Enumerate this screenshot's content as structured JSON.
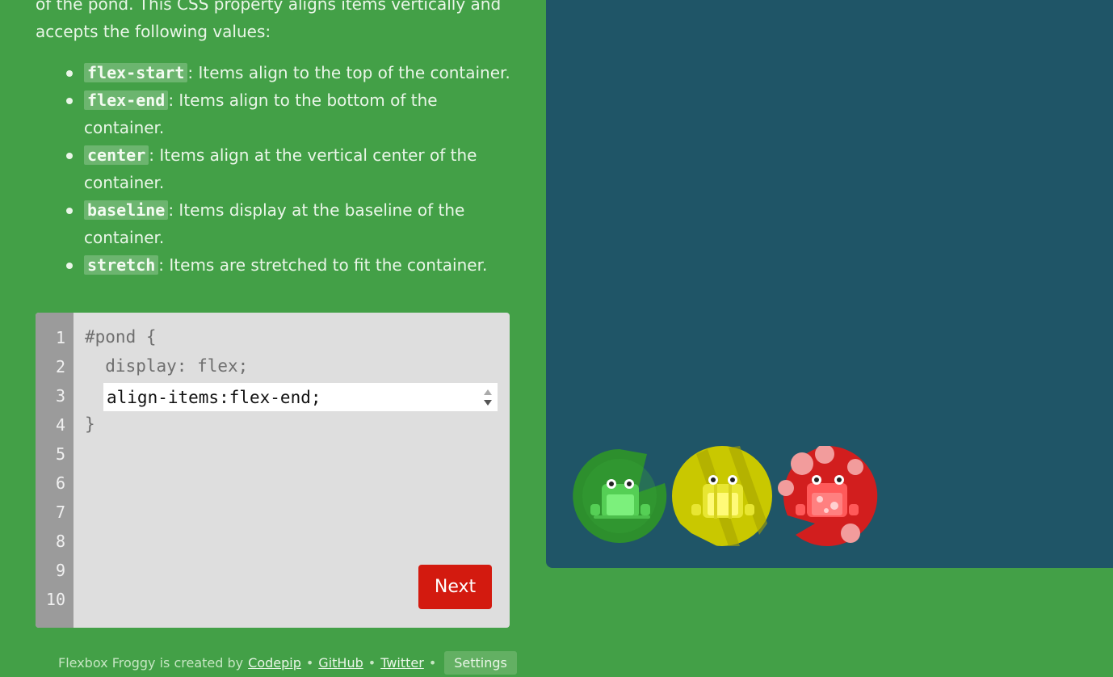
{
  "instructions": {
    "intro": "of the pond. This CSS property aligns items vertically and accepts the following values:",
    "values": [
      {
        "keyword": "flex-start",
        "description": ": Items align to the top of the container."
      },
      {
        "keyword": "flex-end",
        "description": ": Items align to the bottom of the container."
      },
      {
        "keyword": "center",
        "description": ": Items align at the vertical center of the container."
      },
      {
        "keyword": "baseline",
        "description": ": Items display at the baseline of the container."
      },
      {
        "keyword": "stretch",
        "description": ": Items are stretched to fit the container."
      }
    ]
  },
  "editor": {
    "line_numbers": [
      "1",
      "2",
      "3",
      "4",
      "5",
      "6",
      "7",
      "8",
      "9",
      "10"
    ],
    "line1": "#pond {",
    "line2": "  display: flex;",
    "answer_value": "align-items:flex-end;",
    "line4": "}",
    "next_label": "Next"
  },
  "footer": {
    "created_by": "Flexbox Froggy is created by",
    "links": [
      "Codepip",
      "GitHub",
      "Twitter"
    ],
    "separator": "•",
    "settings_label": "Settings"
  },
  "pond": {
    "alignment": "flex-end",
    "frogs": [
      {
        "color": "green",
        "lilypad_hex": "#2e8b2e",
        "frog_hex": "#6de26d"
      },
      {
        "color": "yellow",
        "lilypad_hex": "#c8c800",
        "frog_hex": "#fff86a"
      },
      {
        "color": "red",
        "lilypad_hex": "#d21e1e",
        "frog_hex": "#ff6b6b"
      }
    ]
  }
}
